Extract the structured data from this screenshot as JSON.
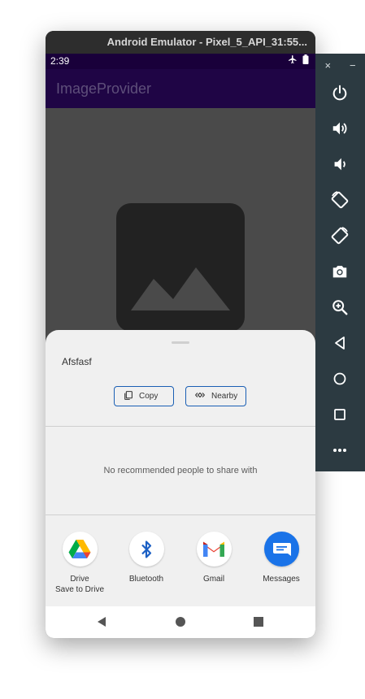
{
  "window": {
    "title": "Android Emulator - Pixel_5_API_31:55..."
  },
  "status_bar": {
    "time": "2:39",
    "icons": [
      "airplane-icon",
      "battery-icon"
    ]
  },
  "app_bar": {
    "title": "ImageProvider"
  },
  "content": {
    "placeholder_icon": "image-placeholder-icon"
  },
  "share_sheet": {
    "title": "Afsfasf",
    "actions": [
      {
        "label": "Copy",
        "icon": "copy-icon"
      },
      {
        "label": "Nearby",
        "icon": "nearby-icon"
      }
    ],
    "empty_message": "No recommended people to share with",
    "targets": [
      {
        "name": "Drive",
        "subname": "Save to Drive",
        "icon": "google-drive-icon"
      },
      {
        "name": "Bluetooth",
        "subname": "",
        "icon": "bluetooth-icon"
      },
      {
        "name": "Gmail",
        "subname": "",
        "icon": "gmail-icon"
      },
      {
        "name": "Messages",
        "subname": "",
        "icon": "messages-icon"
      }
    ]
  },
  "nav_bar": {
    "buttons": [
      "back-icon",
      "home-icon",
      "recents-icon"
    ]
  },
  "emulator_panel": {
    "close_label": "×",
    "minimize_label": "−",
    "buttons": [
      "power-icon",
      "volume-up-icon",
      "volume-down-icon",
      "rotate-left-icon",
      "rotate-right-icon",
      "camera-icon",
      "zoom-icon",
      "back-icon",
      "home-icon",
      "overview-icon",
      "more-icon"
    ]
  },
  "colors": {
    "status_bar": "#19003a",
    "app_bar": "#1f0545",
    "content_bg": "#4a4a4a",
    "sheet_bg": "#f0f0f0",
    "chip_border": "#1a5fb4",
    "emulator_panel": "#2c3a41",
    "messages_blue": "#1a73e8"
  }
}
